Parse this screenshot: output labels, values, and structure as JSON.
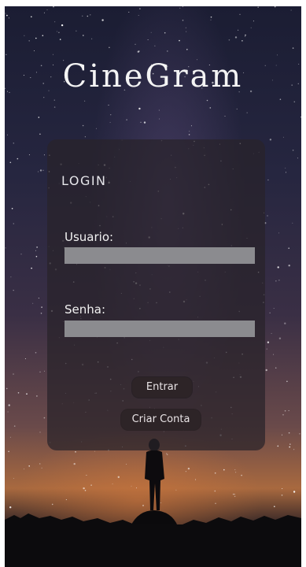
{
  "app": {
    "title": "CineGram"
  },
  "login": {
    "heading": "LOGIN",
    "username_label": "Usuario:",
    "username_value": "",
    "password_label": "Senha:",
    "password_value": "",
    "submit_label": "Entrar",
    "create_account_label": "Criar Conta"
  },
  "colors": {
    "card_background": "#28222a",
    "input_background": "#8b8b8f",
    "button_background": "#2d2427",
    "text": "#f2f2f2"
  },
  "background": {
    "icon": "starry-night-silhouette"
  }
}
